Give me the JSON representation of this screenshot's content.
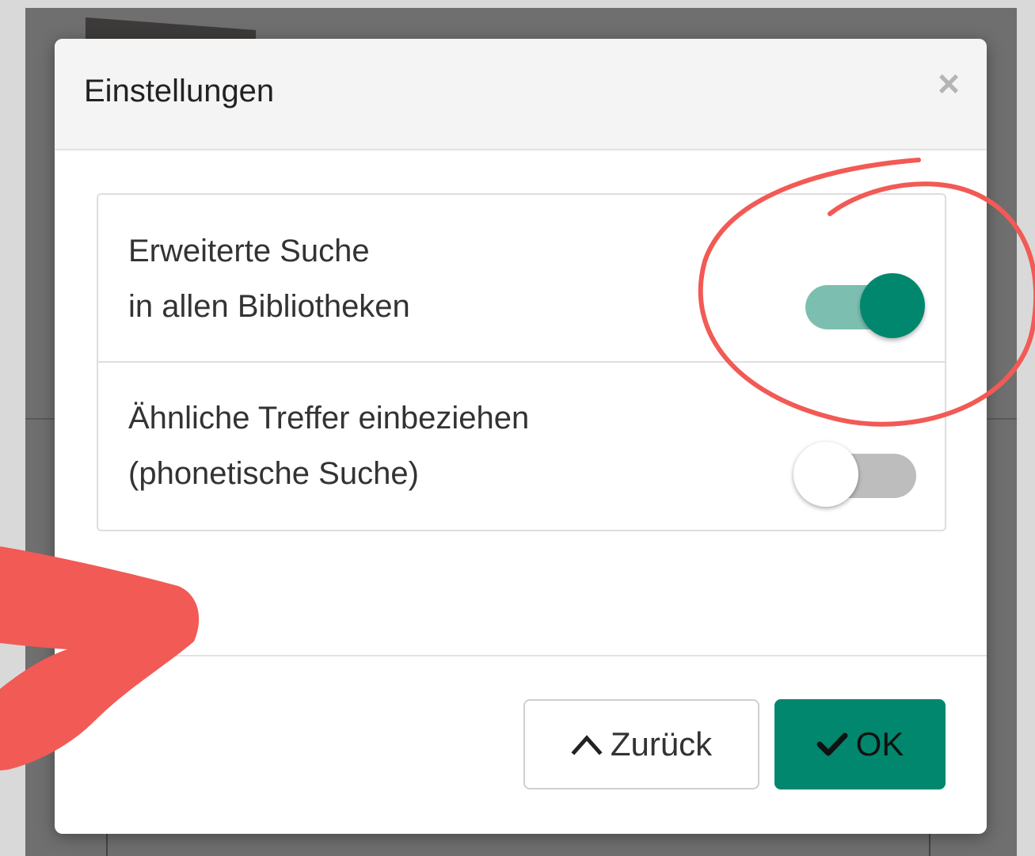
{
  "dialog": {
    "title": "Einstellungen",
    "close_icon": "close-icon"
  },
  "settings": [
    {
      "line1": "Erweiterte Suche",
      "line2": "in allen Bibliotheken",
      "enabled": true,
      "accent": "#00876d"
    },
    {
      "line1": "Ähnliche Treffer einbeziehen",
      "line2": "(phonetische Suche)",
      "enabled": false
    }
  ],
  "footer": {
    "back_label": "Zurück",
    "back_icon": "chevron-up-icon",
    "ok_label": "OK",
    "ok_icon": "checkmark-icon"
  },
  "annotations": {
    "color": "#f25a55",
    "circle_target": "toggle-advanced-search",
    "arrow_icon": "arrow-annotation"
  }
}
